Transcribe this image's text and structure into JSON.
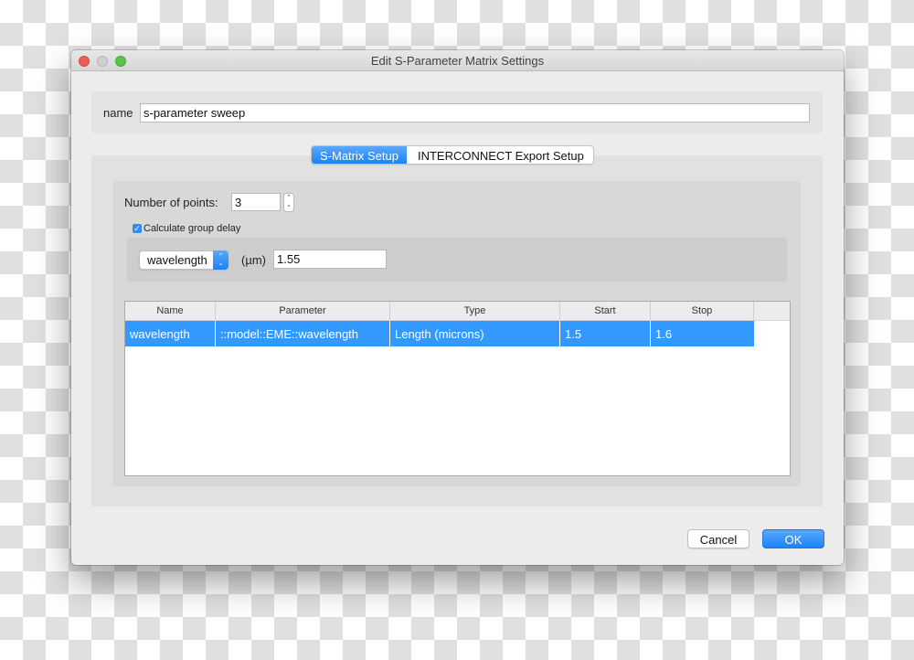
{
  "window": {
    "title": "Edit S-Parameter Matrix Settings",
    "controls": [
      "close",
      "minimize",
      "zoom"
    ]
  },
  "name_field": {
    "label": "name",
    "value": "s-parameter sweep"
  },
  "tabs": [
    {
      "label": "S-Matrix Setup",
      "active": true
    },
    {
      "label": "INTERCONNECT Export Setup",
      "active": false
    }
  ],
  "smatrix": {
    "num_points_label": "Number of points:",
    "num_points_value": "3",
    "stepper_up": "⌃",
    "stepper_down": "⌄",
    "group_delay_label": "Calculate group delay",
    "group_delay_checked": true,
    "checkmark": "✓",
    "sweep_select_value": "wavelength",
    "select_arrows": "⌃⌄",
    "unit_label": "(µm)",
    "center_value": "1.55"
  },
  "table": {
    "columns": [
      "Name",
      "Parameter",
      "Type",
      "Start",
      "Stop"
    ],
    "rows": [
      {
        "name": "wavelength",
        "parameter": "::model::EME::wavelength",
        "type": "Length (microns)",
        "start": "1.5",
        "stop": "1.6",
        "selected": true
      }
    ]
  },
  "buttons": {
    "cancel": "Cancel",
    "ok": "OK"
  },
  "colors": {
    "accent": "#1c82f7",
    "selection": "#3399ff"
  }
}
